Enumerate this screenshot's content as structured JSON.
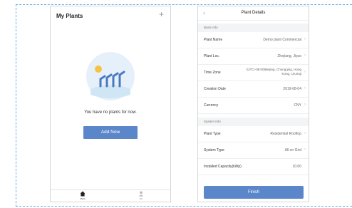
{
  "colors": {
    "accent": "#5b86c9",
    "frame": "#6aaee0",
    "illustration_bg": "#e6f0fb",
    "sun": "#f5c243",
    "tower": "#4a78c2"
  },
  "my_plants": {
    "title": "My Plants",
    "add_icon": "plus-icon",
    "empty_text": "You have no plants for now.",
    "add_now": "Add Now",
    "tabs": [
      {
        "label": "Plant",
        "icon": "home-icon"
      },
      {
        "label": "Me",
        "icon": "user-icon"
      }
    ]
  },
  "plant_details": {
    "title": "Plant Details",
    "back_icon": "chevron-left-icon",
    "basic_info": {
      "label": "Basic Info",
      "rows": [
        {
          "label": "Plant Name",
          "value": "Demo plant Commercial"
        },
        {
          "label": "Plant Loc.",
          "value": "Zhejiang, Jiyao"
        },
        {
          "label": "Time Zone",
          "value": "(UTC+08:00)Beijing, Chongqing, Hong Kong, Urumqi"
        },
        {
          "label": "Creation Date",
          "value": "2019-08-04"
        },
        {
          "label": "Currency",
          "value": "CNY"
        }
      ]
    },
    "system_info": {
      "label": "System Info",
      "rows": [
        {
          "label": "Plant Type",
          "value": "Residential Rooftop"
        },
        {
          "label": "System Type",
          "value": "All on Grid"
        },
        {
          "label": "Installed Capacity(kWp)",
          "value": "10.00"
        }
      ]
    },
    "finish": "Finish"
  }
}
